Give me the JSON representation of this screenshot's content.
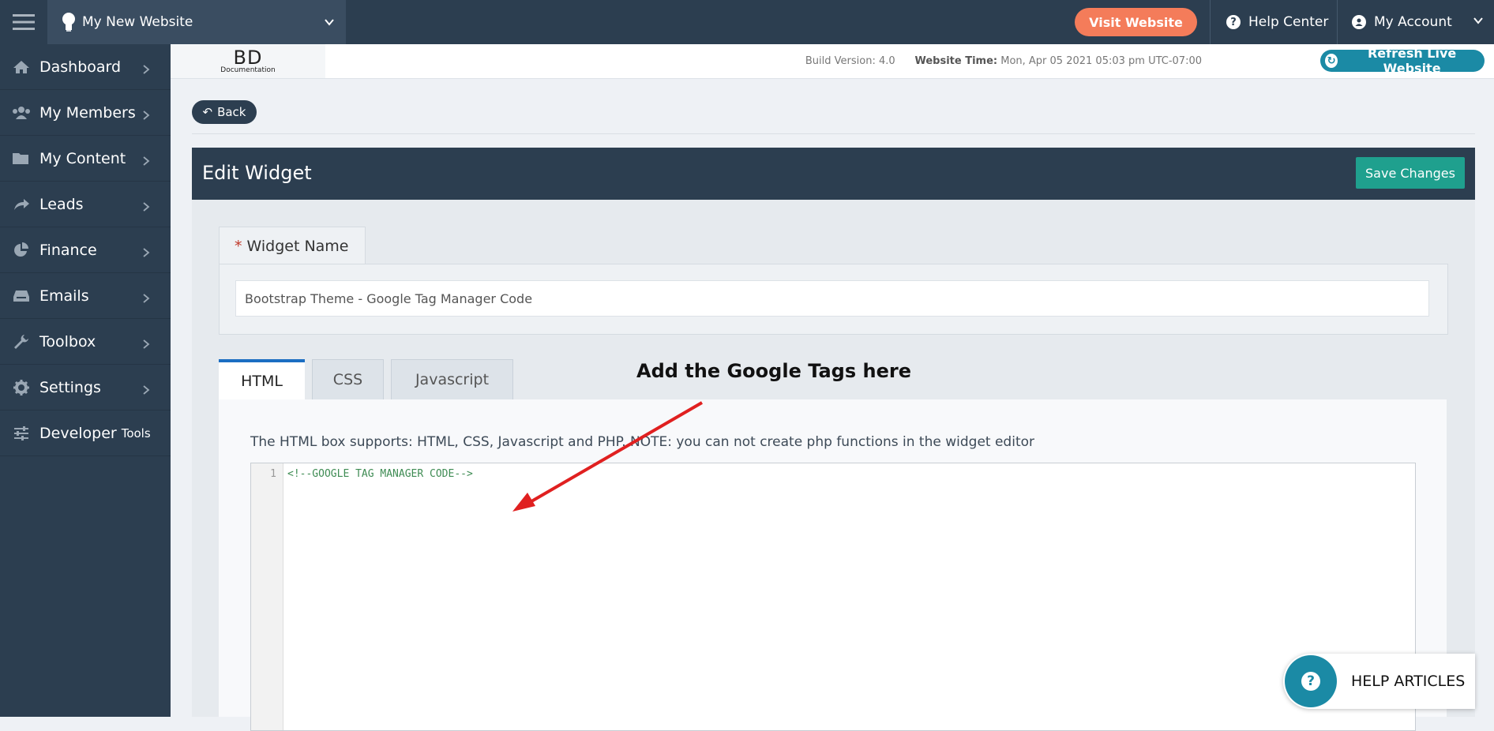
{
  "topbar": {
    "site_name": "My New Website",
    "visit_label": "Visit Website",
    "help_center_label": "Help Center",
    "my_account_label": "My Account"
  },
  "sidebar": {
    "items": [
      {
        "label": "Dashboard",
        "icon": "home-icon"
      },
      {
        "label": "My Members",
        "icon": "users-icon"
      },
      {
        "label": "My Content",
        "icon": "folder-icon"
      },
      {
        "label": "Leads",
        "icon": "share-icon"
      },
      {
        "label": "Finance",
        "icon": "pie-chart-icon"
      },
      {
        "label": "Emails",
        "icon": "inbox-icon"
      },
      {
        "label": "Toolbox",
        "icon": "wrench-icon"
      },
      {
        "label": "Settings",
        "icon": "gear-icon"
      },
      {
        "label": "Developer",
        "suffix": "Tools",
        "icon": "sliders-icon"
      }
    ]
  },
  "subheader": {
    "logo_main": "BD",
    "logo_sub": "Documentation",
    "build_label": "Build Version: 4.0",
    "time_label": "Website Time:",
    "time_value": "Mon, Apr 05 2021 05:03 pm UTC-07:00",
    "refresh_label": "Refresh Live Website"
  },
  "back_label": "Back",
  "panel": {
    "title": "Edit Widget",
    "save_label": "Save Changes"
  },
  "widget_name": {
    "label": "Widget Name",
    "required_mark": "*",
    "value": "Bootstrap Theme - Google Tag Manager Code"
  },
  "tabs": [
    {
      "label": "HTML",
      "active": true
    },
    {
      "label": "CSS",
      "active": false
    },
    {
      "label": "Javascript",
      "active": false
    }
  ],
  "editor": {
    "hint": "The HTML box supports: HTML, CSS, Javascript and PHP. NOTE: you can not create php functions in the widget editor",
    "line_number": "1",
    "code": "<!--GOOGLE TAG MANAGER CODE-->"
  },
  "annotation": {
    "text": "Add the Google Tags here",
    "color": "#e02020"
  },
  "help_articles_label": "HELP ARTICLES",
  "colors": {
    "nav_bg": "#2c3e50",
    "visit": "#f47c5a",
    "refresh": "#1b8aa5",
    "save": "#1fa08e",
    "active_tab": "#1b6ec2"
  }
}
